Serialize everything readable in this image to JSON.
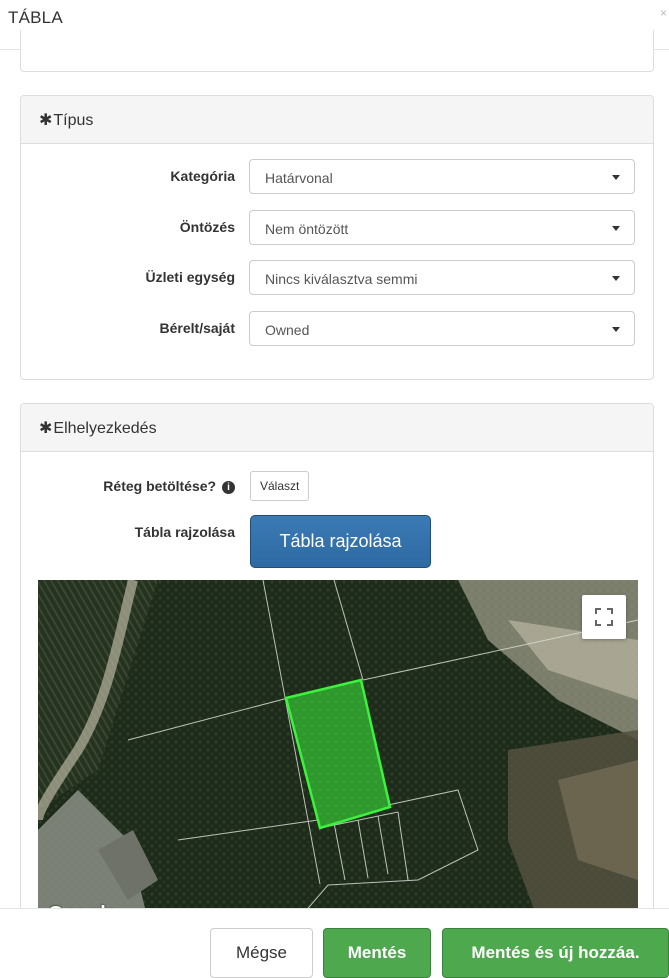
{
  "modal": {
    "title": "TÁBLA",
    "close_symbol": "×"
  },
  "tipus": {
    "heading": "Típus",
    "required_mark": "✱",
    "fields": [
      {
        "label": "Kategória",
        "value": "Határvonal"
      },
      {
        "label": "Öntözés",
        "value": "Nem öntözött"
      },
      {
        "label": "Üzleti egység",
        "value": "Nincs kiválasztva semmi"
      },
      {
        "label": "Bérelt/saját",
        "value": "Owned"
      }
    ]
  },
  "elhelyezkedes": {
    "heading": "Elhelyezkedés",
    "required_mark": "✱",
    "layer_label": "Réteg betöltése?",
    "info_icon": "info-circle-icon",
    "layer_button": "Választ",
    "draw_label": "Tábla rajzolása",
    "draw_button": "Tábla rajzolása",
    "map": {
      "attribution": "Google",
      "fullscreen_icon": "fullscreen-icon",
      "polygon_color": "#3df23d"
    }
  },
  "footer": {
    "cancel": "Mégse",
    "save": "Mentés",
    "save_new": "Mentés és új hozzáa."
  },
  "colors": {
    "primary": "#2d6aa3",
    "success": "#4ea84e"
  }
}
